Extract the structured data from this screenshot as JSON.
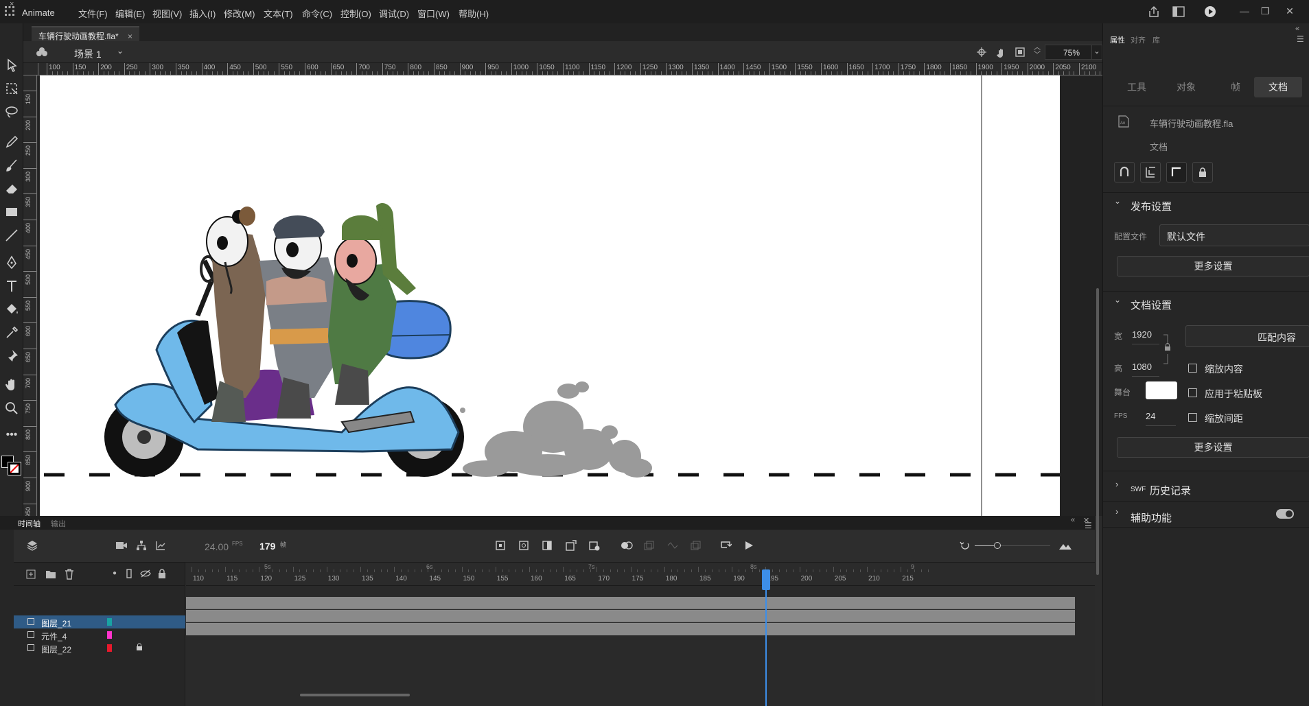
{
  "app": {
    "name": "Animate",
    "menus": [
      "文件(F)",
      "编辑(E)",
      "视图(V)",
      "插入(I)",
      "修改(M)",
      "文本(T)",
      "命令(C)",
      "控制(O)",
      "调试(D)",
      "窗口(W)",
      "帮助(H)"
    ]
  },
  "document": {
    "tab_title": "车辆行驶动画教程.fla*",
    "scene": "场景 1",
    "zoom": "75%"
  },
  "rulers": {
    "h_ticks": [
      "100",
      "150",
      "200",
      "250",
      "300",
      "350",
      "400",
      "450",
      "500",
      "550",
      "600",
      "650",
      "700",
      "750",
      "800",
      "850",
      "900",
      "950",
      "1000",
      "1050",
      "1100",
      "1150",
      "1200",
      "1250",
      "1300",
      "1350",
      "1400",
      "1450",
      "1500",
      "1550",
      "1600",
      "1650",
      "1700",
      "1750",
      "1800",
      "1850",
      "1900",
      "1950",
      "2000",
      "2050",
      "2100"
    ],
    "v_ticks": [
      "150",
      "200",
      "250",
      "300",
      "350",
      "400",
      "450",
      "500",
      "550",
      "600",
      "650",
      "700",
      "750",
      "800",
      "850",
      "900",
      "950"
    ]
  },
  "timeline": {
    "tabs": [
      "时间轴",
      "输出"
    ],
    "fps": "24.00",
    "fps_unit": "FPS",
    "current_frame": "179",
    "frame_unit": "帧",
    "frame_ticks": [
      "110",
      "115",
      "120",
      "125",
      "130",
      "135",
      "140",
      "145",
      "150",
      "155",
      "160",
      "165",
      "170",
      "175",
      "180",
      "185",
      "190",
      "195",
      "200",
      "205",
      "210",
      "215"
    ],
    "second_marks": [
      "5s",
      "6s",
      "7s",
      "8s",
      "9"
    ],
    "layers": [
      {
        "name": "图层_21",
        "color": "#19a3a3",
        "locked": false,
        "active": true
      },
      {
        "name": "元件_4",
        "color": "#ff33cc",
        "locked": false,
        "active": false
      },
      {
        "name": "图层_22",
        "color": "#e8192c",
        "locked": true,
        "active": false
      }
    ]
  },
  "properties": {
    "tabs": [
      "属性",
      "对齐",
      "库"
    ],
    "seg_tabs": [
      "工具",
      "对象",
      "帧",
      "文档"
    ],
    "doc_name": "车辆行驶动画教程.fla",
    "doc_type": "文档",
    "publish_section": "发布设置",
    "profile_label": "配置文件",
    "profile_value": "默认文件",
    "more_settings": "更多设置",
    "doc_section": "文档设置",
    "width_label": "宽",
    "width_value": "1920",
    "height_label": "高",
    "height_value": "1080",
    "match_contents": "匹配内容",
    "scale_content": "缩放内容",
    "apply_pasteboard": "应用于粘贴板",
    "scale_spacing": "缩放间距",
    "stage_label": "舞台",
    "stage_color": "#ffffff",
    "fps_label": "FPS",
    "fps_value": "24",
    "more_settings2": "更多设置",
    "swf_section_prefix": "SWF",
    "swf_section": "历史记录",
    "accessibility": "辅助功能"
  }
}
